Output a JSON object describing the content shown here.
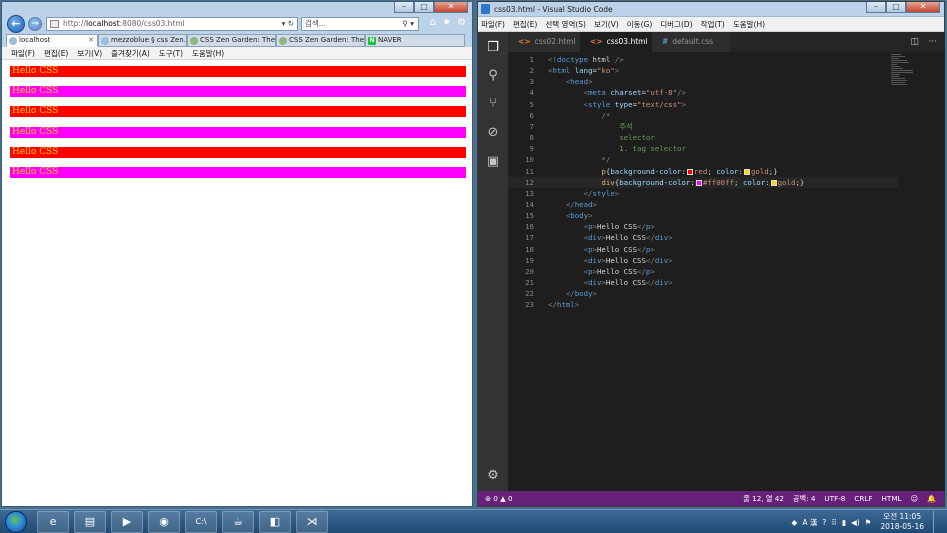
{
  "browser": {
    "address": {
      "prefix": "http://",
      "host": "localhost",
      "rest": ":8080/css03.html"
    },
    "search_placeholder": "검색...",
    "tabs": [
      {
        "label": "localhost",
        "active": true
      },
      {
        "label": "mezzoblue § css Zen...",
        "active": false
      },
      {
        "label": "CSS Zen Garden: The...",
        "active": false
      },
      {
        "label": "CSS Zen Garden: The...",
        "active": false
      },
      {
        "label": "NAVER",
        "active": false
      }
    ],
    "menu": [
      "파일(F)",
      "편집(E)",
      "보기(V)",
      "즐겨찾기(A)",
      "도구(T)",
      "도움말(H)"
    ],
    "content": [
      {
        "text": "Hello CSS",
        "tag": "p",
        "bg": "#ff0000",
        "color": "#ffd700"
      },
      {
        "text": "Hello CSS",
        "tag": "div",
        "bg": "#ff00ff",
        "color": "#ffd700"
      },
      {
        "text": "Hello CSS",
        "tag": "p",
        "bg": "#ff0000",
        "color": "#ffd700"
      },
      {
        "text": "Hello CSS",
        "tag": "div",
        "bg": "#ff00ff",
        "color": "#ffd700"
      },
      {
        "text": "Hello CSS",
        "tag": "p",
        "bg": "#ff0000",
        "color": "#ffd700"
      },
      {
        "text": "Hello CSS",
        "tag": "div",
        "bg": "#ff00ff",
        "color": "#ffd700"
      }
    ]
  },
  "vscode": {
    "title": "css03.html - Visual Studio Code",
    "menu": [
      "파일(F)",
      "편집(E)",
      "선택 영역(S)",
      "보기(V)",
      "이동(G)",
      "디버그(D)",
      "작업(T)",
      "도움말(H)"
    ],
    "tabs": [
      {
        "label": "css02.html",
        "ext": "<>",
        "active": false
      },
      {
        "label": "css03.html",
        "ext": "<>",
        "active": true
      },
      {
        "label": "default.css",
        "ext": "#",
        "active": false
      }
    ],
    "code": [
      [
        [
          "t-br",
          "<!"
        ],
        [
          "t-tag",
          "doctype"
        ],
        [
          "t-txt",
          " html "
        ],
        [
          "t-br",
          "/>"
        ]
      ],
      [
        [
          "t-br",
          "<"
        ],
        [
          "t-tag",
          "html"
        ],
        [
          "t-txt",
          " "
        ],
        [
          "t-attr",
          "lang"
        ],
        [
          "t-txt",
          "="
        ],
        [
          "t-str",
          "\"ko\""
        ],
        [
          "t-br",
          ">"
        ]
      ],
      [
        [
          "t-txt",
          "    "
        ],
        [
          "t-br",
          "<"
        ],
        [
          "t-tag",
          "head"
        ],
        [
          "t-br",
          ">"
        ]
      ],
      [
        [
          "t-txt",
          "        "
        ],
        [
          "t-br",
          "<"
        ],
        [
          "t-tag",
          "meta"
        ],
        [
          "t-txt",
          " "
        ],
        [
          "t-attr",
          "charset"
        ],
        [
          "t-txt",
          "="
        ],
        [
          "t-str",
          "\"utf-8\""
        ],
        [
          "t-br",
          "/>"
        ]
      ],
      [
        [
          "t-txt",
          "        "
        ],
        [
          "t-br",
          "<"
        ],
        [
          "t-tag",
          "style"
        ],
        [
          "t-txt",
          " "
        ],
        [
          "t-attr",
          "type"
        ],
        [
          "t-txt",
          "="
        ],
        [
          "t-str",
          "\"text/css\""
        ],
        [
          "t-br",
          ">"
        ]
      ],
      [
        [
          "t-txt",
          "            "
        ],
        [
          "t-com",
          "/*"
        ]
      ],
      [
        [
          "t-txt",
          "            "
        ],
        [
          "t-com",
          "    주석"
        ]
      ],
      [
        [
          "t-txt",
          "            "
        ],
        [
          "t-com",
          "    selector"
        ]
      ],
      [
        [
          "t-txt",
          "            "
        ],
        [
          "t-com",
          "    1. tag selector"
        ]
      ],
      [
        [
          "t-txt",
          "            "
        ],
        [
          "t-com",
          "*/"
        ]
      ],
      [
        [
          "t-txt",
          "            "
        ],
        [
          "t-sel",
          "p"
        ],
        [
          "t-txt",
          "{"
        ],
        [
          "t-prop",
          "background-color"
        ],
        [
          "t-txt",
          ":"
        ],
        [
          "sw",
          "#ff0000"
        ],
        [
          "t-val",
          "red"
        ],
        [
          "t-txt",
          "; "
        ],
        [
          "t-prop",
          "color"
        ],
        [
          "t-txt",
          ":"
        ],
        [
          "sw",
          "#ffd700"
        ],
        [
          "t-val",
          "gold"
        ],
        [
          "t-txt",
          ";}"
        ]
      ],
      [
        [
          "t-txt",
          "            "
        ],
        [
          "t-sel",
          "div"
        ],
        [
          "t-txt",
          "{"
        ],
        [
          "t-prop",
          "background-color"
        ],
        [
          "t-txt",
          ":"
        ],
        [
          "sw",
          "#ff00ff"
        ],
        [
          "t-val",
          "#ff00ff"
        ],
        [
          "t-txt",
          "; "
        ],
        [
          "t-prop",
          "color"
        ],
        [
          "t-txt",
          ":"
        ],
        [
          "sw",
          "#ffd700"
        ],
        [
          "t-val",
          "gold"
        ],
        [
          "t-txt",
          ";}"
        ]
      ],
      [
        [
          "t-txt",
          "        "
        ],
        [
          "t-br",
          "</"
        ],
        [
          "t-tag",
          "style"
        ],
        [
          "t-br",
          ">"
        ]
      ],
      [
        [
          "t-txt",
          "    "
        ],
        [
          "t-br",
          "</"
        ],
        [
          "t-tag",
          "head"
        ],
        [
          "t-br",
          ">"
        ]
      ],
      [
        [
          "t-txt",
          "    "
        ],
        [
          "t-br",
          "<"
        ],
        [
          "t-tag",
          "body"
        ],
        [
          "t-br",
          ">"
        ]
      ],
      [
        [
          "t-txt",
          "        "
        ],
        [
          "t-br",
          "<"
        ],
        [
          "t-tag",
          "p"
        ],
        [
          "t-br",
          ">"
        ],
        [
          "t-txt",
          "Hello CSS"
        ],
        [
          "t-br",
          "</"
        ],
        [
          "t-tag",
          "p"
        ],
        [
          "t-br",
          ">"
        ]
      ],
      [
        [
          "t-txt",
          "        "
        ],
        [
          "t-br",
          "<"
        ],
        [
          "t-tag",
          "div"
        ],
        [
          "t-br",
          ">"
        ],
        [
          "t-txt",
          "Hello CSS"
        ],
        [
          "t-br",
          "</"
        ],
        [
          "t-tag",
          "div"
        ],
        [
          "t-br",
          ">"
        ]
      ],
      [
        [
          "t-txt",
          "        "
        ],
        [
          "t-br",
          "<"
        ],
        [
          "t-tag",
          "p"
        ],
        [
          "t-br",
          ">"
        ],
        [
          "t-txt",
          "Hello CSS"
        ],
        [
          "t-br",
          "</"
        ],
        [
          "t-tag",
          "p"
        ],
        [
          "t-br",
          ">"
        ]
      ],
      [
        [
          "t-txt",
          "        "
        ],
        [
          "t-br",
          "<"
        ],
        [
          "t-tag",
          "div"
        ],
        [
          "t-br",
          ">"
        ],
        [
          "t-txt",
          "Hello CSS"
        ],
        [
          "t-br",
          "</"
        ],
        [
          "t-tag",
          "div"
        ],
        [
          "t-br",
          ">"
        ]
      ],
      [
        [
          "t-txt",
          "        "
        ],
        [
          "t-br",
          "<"
        ],
        [
          "t-tag",
          "p"
        ],
        [
          "t-br",
          ">"
        ],
        [
          "t-txt",
          "Hello CSS"
        ],
        [
          "t-br",
          "</"
        ],
        [
          "t-tag",
          "p"
        ],
        [
          "t-br",
          ">"
        ]
      ],
      [
        [
          "t-txt",
          "        "
        ],
        [
          "t-br",
          "<"
        ],
        [
          "t-tag",
          "div"
        ],
        [
          "t-br",
          ">"
        ],
        [
          "t-txt",
          "Hello CSS"
        ],
        [
          "t-br",
          "</"
        ],
        [
          "t-tag",
          "div"
        ],
        [
          "t-br",
          ">"
        ]
      ],
      [
        [
          "t-txt",
          "    "
        ],
        [
          "t-br",
          "</"
        ],
        [
          "t-tag",
          "body"
        ],
        [
          "t-br",
          ">"
        ]
      ],
      [
        [
          "t-br",
          "</"
        ],
        [
          "t-tag",
          "html"
        ],
        [
          "t-br",
          ">"
        ]
      ]
    ],
    "current_line": 12,
    "status": {
      "problems": "⊗ 0 ▲ 0",
      "position": "줄 12, 열 42",
      "spaces": "공백: 4",
      "encoding": "UTF-8",
      "eol": "CRLF",
      "language": "HTML",
      "smiley": "☺",
      "bell": "🔔"
    }
  },
  "taskbar": {
    "apps": [
      {
        "name": "ie",
        "glyph": "e"
      },
      {
        "name": "explorer",
        "glyph": "▤"
      },
      {
        "name": "media",
        "glyph": "▶"
      },
      {
        "name": "chrome",
        "glyph": "◉"
      },
      {
        "name": "cmd",
        "glyph": "C:\\"
      },
      {
        "name": "java",
        "glyph": "☕"
      },
      {
        "name": "eclipse",
        "glyph": "◧"
      },
      {
        "name": "vscode",
        "glyph": "⋊"
      }
    ],
    "tray": {
      "lang": "A 漢",
      "clock_time": "오전 11:05",
      "clock_date": "2018-05-16"
    }
  }
}
